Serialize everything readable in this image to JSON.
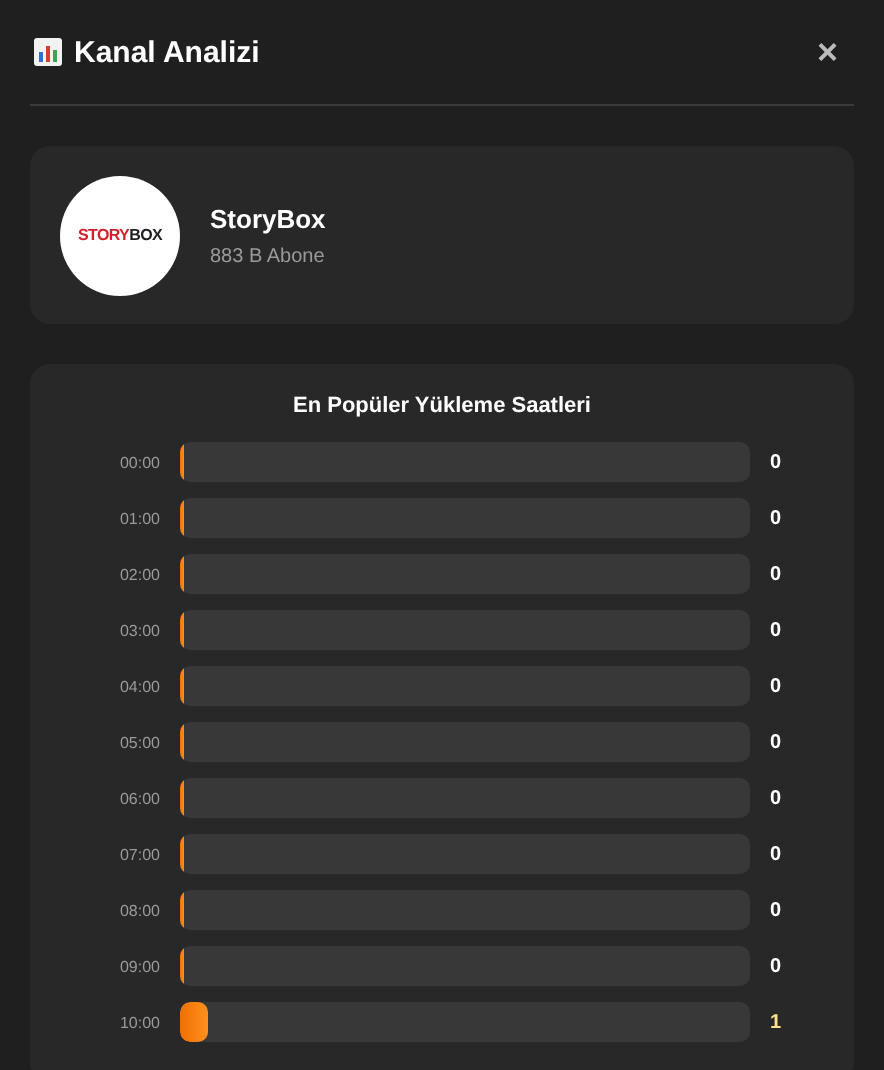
{
  "header": {
    "title": "Kanal Analizi",
    "close": "×"
  },
  "channel": {
    "name": "StoryBox",
    "subscribers": "883 B Abone",
    "logo_text_left": "STORY",
    "logo_text_right": "BOX"
  },
  "chart": {
    "title": "En Popüler Yükleme Saatleri",
    "rows": [
      {
        "hour": "00:00",
        "level": 0,
        "count": "0",
        "highlighted": false
      },
      {
        "hour": "01:00",
        "level": 0,
        "count": "0",
        "highlighted": false
      },
      {
        "hour": "02:00",
        "level": 0,
        "count": "0",
        "highlighted": false
      },
      {
        "hour": "03:00",
        "level": 0,
        "count": "0",
        "highlighted": false
      },
      {
        "hour": "04:00",
        "level": 0,
        "count": "0",
        "highlighted": false
      },
      {
        "hour": "05:00",
        "level": 0,
        "count": "0",
        "highlighted": false
      },
      {
        "hour": "06:00",
        "level": 0,
        "count": "0",
        "highlighted": false
      },
      {
        "hour": "07:00",
        "level": 0,
        "count": "0",
        "highlighted": false
      },
      {
        "hour": "08:00",
        "level": 0,
        "count": "0",
        "highlighted": false
      },
      {
        "hour": "09:00",
        "level": 0,
        "count": "0",
        "highlighted": false
      },
      {
        "hour": "10:00",
        "level": 0.05,
        "count": "1",
        "highlighted": true
      }
    ]
  }
}
